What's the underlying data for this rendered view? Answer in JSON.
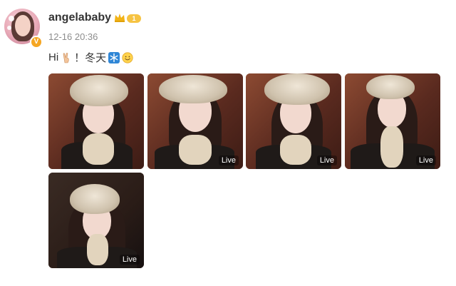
{
  "post": {
    "username": "angelababy",
    "level": "1",
    "timestamp": "12-16 20:36",
    "text_parts": [
      "Hi",
      "！冬天"
    ],
    "verified_badge": "V"
  },
  "photos": [
    {
      "live": ""
    },
    {
      "live": "Live"
    },
    {
      "live": "Live"
    },
    {
      "live": "Live"
    },
    {
      "live": "Live"
    }
  ],
  "icons": [
    "crown-icon",
    "victory-hand-icon",
    "snowflake-icon",
    "smile-emoji-icon"
  ],
  "colors": {
    "accent": "#f5a623",
    "text": "#333333",
    "muted": "#8d8d8d"
  }
}
